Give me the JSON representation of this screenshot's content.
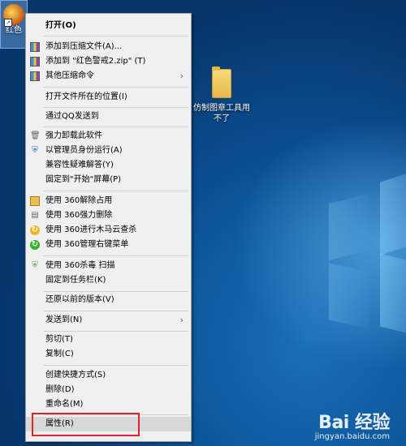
{
  "desktop": {
    "selected_icon_label": "红色",
    "folder_label": "仿制图章工具用不了"
  },
  "context_menu": {
    "items": [
      {
        "label": "打开(O)",
        "bold": true
      },
      {
        "label": "添加到压缩文件(A)...",
        "icon": "archive-icon"
      },
      {
        "label": "添加到 \"红色警戒2.zip\" (T)",
        "icon": "archive-icon"
      },
      {
        "label": "其他压缩命令",
        "icon": "archive-icon",
        "submenu": true
      },
      {
        "label": "打开文件所在的位置(I)"
      },
      {
        "label": "通过QQ发送到"
      },
      {
        "label": "强力卸载此软件",
        "icon": "trash-icon"
      },
      {
        "label": "以管理员身份运行(A)",
        "icon": "shield-icon"
      },
      {
        "label": "兼容性疑难解答(Y)"
      },
      {
        "label": "固定到\"开始\"屏幕(P)"
      },
      {
        "label": "使用 360解除占用",
        "icon": "unlock-box-icon"
      },
      {
        "label": "使用 360强力删除",
        "icon": "shredder-icon"
      },
      {
        "label": "使用 360进行木马云查杀",
        "icon": "360-icon"
      },
      {
        "label": "使用 360管理右键菜单",
        "icon": "360-icon"
      },
      {
        "label": "使用 360杀毒 扫描",
        "icon": "shield-check-icon"
      },
      {
        "label": "固定到任务栏(K)"
      },
      {
        "label": "还原以前的版本(V)"
      },
      {
        "label": "发送到(N)",
        "submenu": true
      },
      {
        "label": "剪切(T)"
      },
      {
        "label": "复制(C)"
      },
      {
        "label": "创建快捷方式(S)"
      },
      {
        "label": "删除(D)"
      },
      {
        "label": "重命名(M)"
      },
      {
        "label": "属性(R)",
        "selected": true
      }
    ]
  },
  "watermark": {
    "main": "Bai 经验",
    "sub": "jingyan.baidu.com"
  },
  "colors": {
    "highlight_border": "#e0212b",
    "menu_background": "#f0f0f0"
  }
}
